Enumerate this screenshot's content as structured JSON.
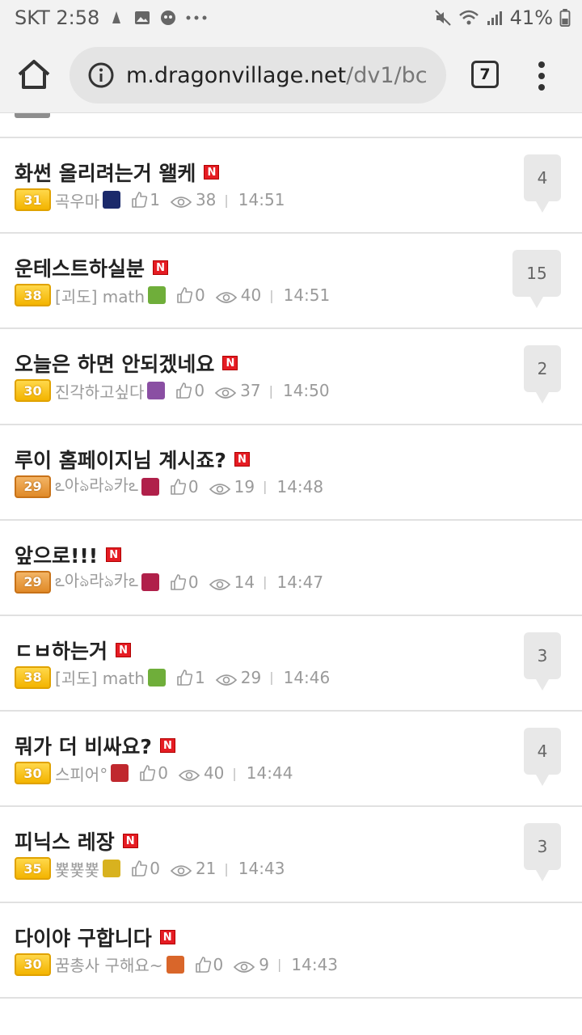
{
  "status": {
    "carrier_time": "SKT 2:58",
    "battery": "41%",
    "icons": [
      "notification-icon",
      "gallery-icon",
      "app-icon",
      "more-dots-icon",
      "mute-icon",
      "wifi-icon",
      "signal-icon",
      "battery-icon"
    ]
  },
  "browser": {
    "url_host": "m.dragonvillage.net",
    "url_path": "/dv1/bc",
    "tab_count": "7"
  },
  "posts": [
    {
      "title": "화썬 올리려는거 왤케",
      "level": "31",
      "level_color": "gold",
      "author": "곡우마",
      "likes": "1",
      "views": "38",
      "time": "14:51",
      "comments": "4",
      "avatar_color": "#1b2a6b"
    },
    {
      "title": "운테스트하실분",
      "level": "38",
      "level_color": "gold",
      "author": "[괴도] math",
      "likes": "0",
      "views": "40",
      "time": "14:51",
      "comments": "15",
      "avatar_color": "#6fae3a"
    },
    {
      "title": "오늘은 하면 안되겠네요",
      "level": "30",
      "level_color": "gold",
      "author": "진각하고싶다",
      "likes": "0",
      "views": "37",
      "time": "14:50",
      "comments": "2",
      "avatar_color": "#8a4fa3"
    },
    {
      "title": "루이 홈페이지님 계시죠?",
      "level": "29",
      "level_color": "orange",
      "author": "ఽ아ঌ라ঌ카ఽ",
      "likes": "0",
      "views": "19",
      "time": "14:48",
      "comments": "",
      "avatar_color": "#b0204a"
    },
    {
      "title": "앞으로!!!",
      "level": "29",
      "level_color": "orange",
      "author": "ఽ아ঌ라ঌ카ఽ",
      "likes": "0",
      "views": "14",
      "time": "14:47",
      "comments": "",
      "avatar_color": "#b0204a"
    },
    {
      "title": "ㄷㅂ하는거",
      "level": "38",
      "level_color": "gold",
      "author": "[괴도] math",
      "likes": "1",
      "views": "29",
      "time": "14:46",
      "comments": "3",
      "avatar_color": "#6fae3a"
    },
    {
      "title": "뭐가 더 비싸요?",
      "level": "30",
      "level_color": "gold",
      "author": "스피어°",
      "likes": "0",
      "views": "40",
      "time": "14:44",
      "comments": "4",
      "avatar_color": "#c0282e"
    },
    {
      "title": "피닉스 레장",
      "level": "35",
      "level_color": "gold",
      "author": "뿇뿇뿇",
      "likes": "0",
      "views": "21",
      "time": "14:43",
      "comments": "3",
      "avatar_color": "#d8b21f"
    },
    {
      "title": "다이야 구합니다",
      "level": "30",
      "level_color": "gold",
      "author": "꿈총사 구해요~",
      "likes": "0",
      "views": "9",
      "time": "14:43",
      "comments": "",
      "avatar_color": "#d9662a"
    }
  ],
  "new_badge": "N",
  "level_badge_colors": {
    "gold": "#f3b400",
    "orange": "#e08a28"
  }
}
